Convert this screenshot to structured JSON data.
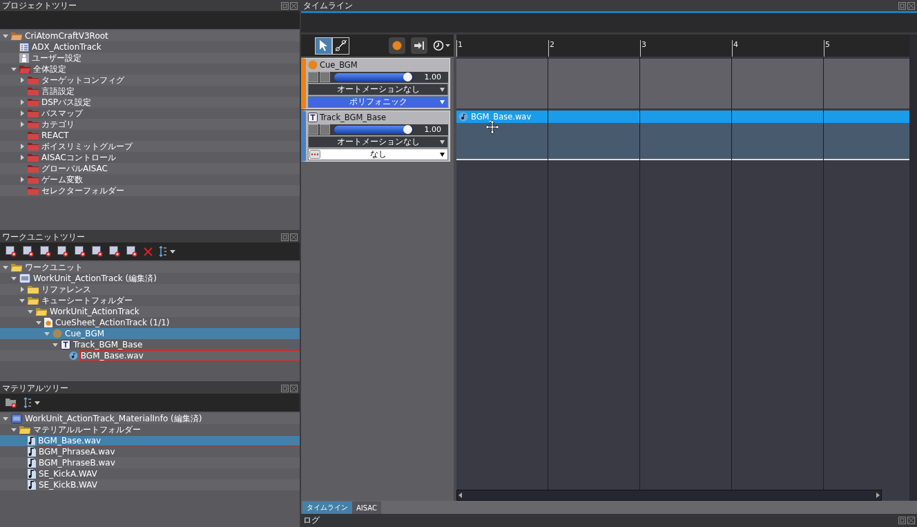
{
  "project_tree": {
    "title": "プロジェクトツリー",
    "items": [
      {
        "label": "CriAtomCraftV3Root",
        "kind": "root",
        "expanded": true,
        "selected": false,
        "focused": false,
        "children": [
          {
            "label": "ADX_ActionTrack",
            "kind": "table",
            "selected": false,
            "focused": false
          },
          {
            "label": "ユーザー設定",
            "kind": "user",
            "selected": false,
            "focused": false
          },
          {
            "label": "全体設定",
            "kind": "red-folder",
            "expanded": true,
            "selected": false,
            "focused": false,
            "children": [
              {
                "label": "ターゲットコンフィグ",
                "kind": "red-folder",
                "expanded": false,
                "selected": false,
                "focused": false
              },
              {
                "label": "言語設定",
                "kind": "red-folder",
                "selected": false,
                "focused": false
              },
              {
                "label": "DSPバス設定",
                "kind": "red-folder",
                "expanded": false,
                "selected": false,
                "focused": false
              },
              {
                "label": "バスマップ",
                "kind": "red-folder",
                "expanded": false,
                "selected": false,
                "focused": false
              },
              {
                "label": "カテゴリ",
                "kind": "red-folder",
                "expanded": false,
                "selected": false,
                "focused": false
              },
              {
                "label": "REACT",
                "kind": "red-folder",
                "selected": false,
                "focused": false
              },
              {
                "label": "ボイスリミットグループ",
                "kind": "red-folder",
                "expanded": false,
                "selected": false,
                "focused": false
              },
              {
                "label": "AISACコントロール",
                "kind": "red-folder",
                "expanded": false,
                "selected": false,
                "focused": false
              },
              {
                "label": "グローバルAISAC",
                "kind": "red-folder",
                "selected": false,
                "focused": false
              },
              {
                "label": "ゲーム変数",
                "kind": "red-folder",
                "expanded": false,
                "selected": false,
                "focused": false
              },
              {
                "label": "セレクターフォルダー",
                "kind": "red-folder",
                "selected": false,
                "focused": false
              }
            ]
          }
        ]
      }
    ]
  },
  "workunit_tree": {
    "title": "ワークユニットツリー",
    "tools": [
      {
        "kind": "add"
      },
      {
        "kind": "add"
      },
      {
        "kind": "add"
      },
      {
        "kind": "add"
      },
      {
        "kind": "add"
      },
      {
        "kind": "add"
      },
      {
        "kind": "add"
      },
      {
        "kind": "add"
      },
      {
        "kind": "delete"
      },
      {
        "kind": "sort"
      }
    ],
    "items": [
      {
        "label": "ワークユニット",
        "kind": "folder",
        "expanded": true,
        "selected": false,
        "focused": false,
        "children": [
          {
            "label": "WorkUnit_ActionTrack (編集済)",
            "kind": "workunit",
            "expanded": true,
            "selected": false,
            "focused": false,
            "children": [
              {
                "label": "リファレンス",
                "kind": "folder",
                "expanded": false,
                "selected": false,
                "focused": false
              },
              {
                "label": "キューシートフォルダー",
                "kind": "folder",
                "expanded": true,
                "selected": false,
                "focused": false,
                "children": [
                  {
                    "label": "WorkUnit_ActionTrack",
                    "kind": "folder",
                    "expanded": true,
                    "selected": false,
                    "focused": false,
                    "children": [
                      {
                        "label": "CueSheet_ActionTrack (1/1)",
                        "kind": "cuesheet",
                        "expanded": true,
                        "selected": false,
                        "focused": false,
                        "children": [
                          {
                            "label": "Cue_BGM",
                            "kind": "cue",
                            "expanded": true,
                            "selected": true,
                            "focused": false,
                            "children": [
                              {
                                "label": "Track_BGM_Base",
                                "kind": "track",
                                "expanded": true,
                                "selected": false,
                                "focused": false,
                                "children": [
                                  {
                                    "label": "BGM_Base.wav",
                                    "kind": "wave",
                                    "selected": false,
                                    "focused": true
                                  }
                                ]
                              }
                            ]
                          }
                        ]
                      }
                    ]
                  }
                ]
              }
            ]
          }
        ]
      }
    ]
  },
  "material_tree": {
    "title": "マテリアルツリー",
    "tools": [
      {
        "kind": "add-folder"
      },
      {
        "kind": "sort"
      }
    ],
    "items": [
      {
        "label": "WorkUnit_ActionTrack_MaterialInfo (編集済)",
        "kind": "material-info",
        "expanded": true,
        "selected": false,
        "focused": false,
        "children": [
          {
            "label": "マテリアルルートフォルダー",
            "kind": "folder",
            "expanded": true,
            "selected": false,
            "focused": false,
            "children": [
              {
                "label": "BGM_Base.wav",
                "kind": "note",
                "selected": true,
                "focused": true
              },
              {
                "label": "BGM_PhraseA.wav",
                "kind": "note",
                "selected": false,
                "focused": false
              },
              {
                "label": "BGM_PhraseB.wav",
                "kind": "note",
                "selected": false,
                "focused": false
              },
              {
                "label": "SE_KickA.WAV",
                "kind": "note",
                "selected": false,
                "focused": false
              },
              {
                "label": "SE_KickB.WAV",
                "kind": "note",
                "selected": false,
                "focused": false
              }
            ]
          }
        ]
      }
    ]
  },
  "timeline": {
    "title": "タイムライン",
    "tools": [
      {
        "kind": "pointer",
        "selected": true
      },
      {
        "kind": "scissors",
        "selected": false
      }
    ],
    "ruler": [
      "1",
      "2",
      "3",
      "4",
      "5"
    ],
    "tracks": [
      {
        "kind": "cue",
        "name": "Cue_BGM",
        "level": 0.93,
        "reading": "1.00",
        "automation": "オートメーションなし",
        "mode": "ポリフォニック"
      },
      {
        "kind": "track",
        "name": "Track_BGM_Base",
        "level": 0.93,
        "reading": "1.00",
        "automation": "オートメーションなし",
        "mode": "なし",
        "clip": "BGM_Base.wav"
      }
    ],
    "tabs": [
      {
        "label": "タイムライン",
        "selected": true
      },
      {
        "label": "AISAC",
        "selected": false
      }
    ]
  },
  "log": {
    "title": "ログ"
  }
}
